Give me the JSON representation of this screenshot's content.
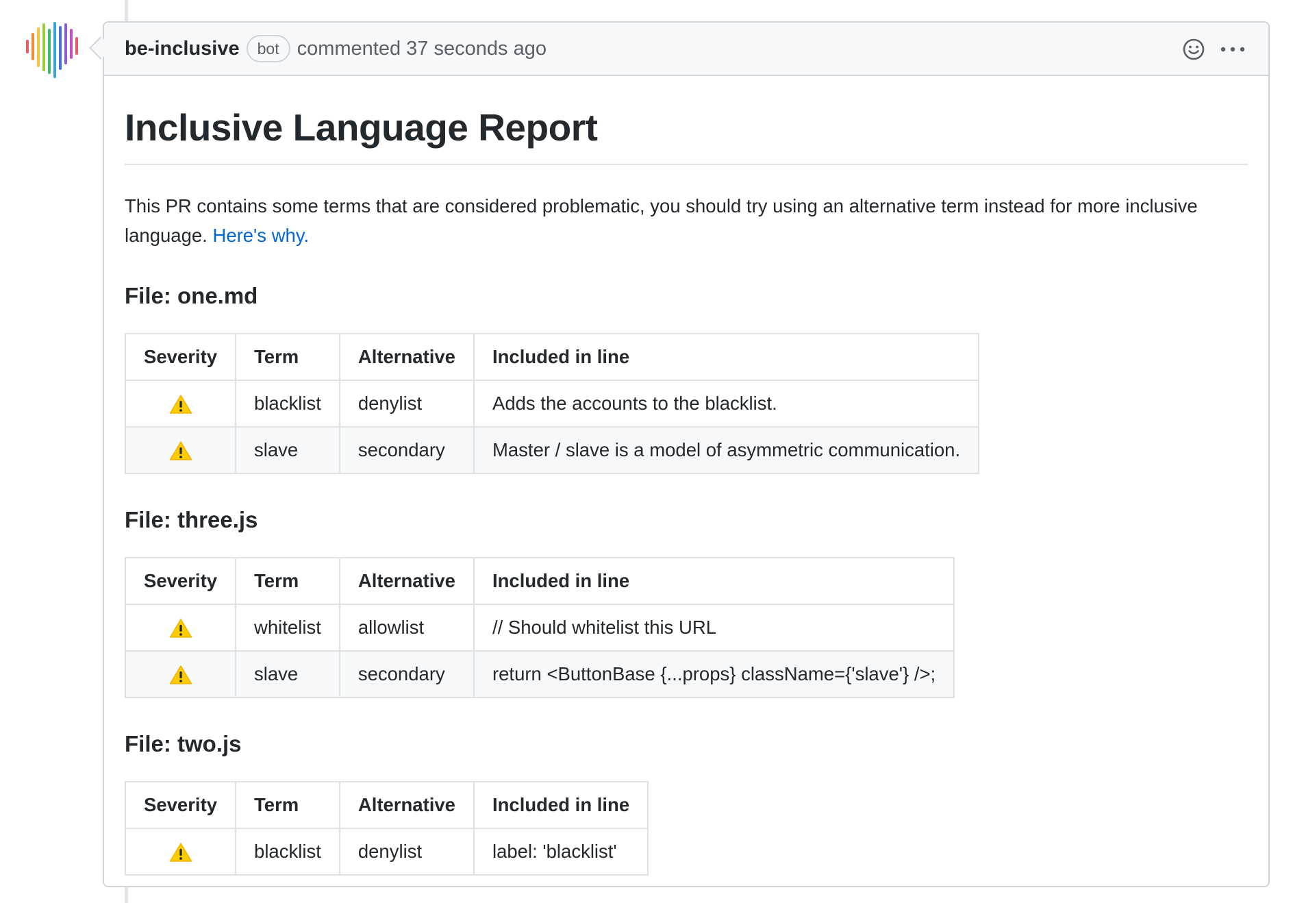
{
  "comment": {
    "author": "be-inclusive",
    "badge": "bot",
    "meta": "commented 37 seconds ago",
    "actions": [
      {
        "name": "add-reaction",
        "icon": "smiley-icon"
      },
      {
        "name": "more-options",
        "icon": "kebab-horizontal-icon"
      }
    ]
  },
  "report": {
    "title": "Inclusive Language Report",
    "intro": "This PR contains some terms that are considered problematic, you should try using an alternative term instead for more inclusive language.",
    "link": "Here's why.",
    "columns": [
      "Severity",
      "Term",
      "Alternative",
      "Included in line"
    ],
    "severity_icon": "warning-icon",
    "files": [
      {
        "heading": "File: one.md",
        "rows": [
          {
            "term": "blacklist",
            "alternative": "denylist",
            "line": "Adds the accounts to the blacklist."
          },
          {
            "term": "slave",
            "alternative": "secondary",
            "line": "Master / slave is a model of asymmetric communication."
          }
        ]
      },
      {
        "heading": "File: three.js",
        "rows": [
          {
            "term": "whitelist",
            "alternative": "allowlist",
            "line": "// Should whitelist this URL"
          },
          {
            "term": "slave",
            "alternative": "secondary",
            "line": "return <ButtonBase {...props} className={'slave'} />;"
          }
        ]
      },
      {
        "heading": "File: two.js",
        "rows": [
          {
            "term": "blacklist",
            "alternative": "denylist",
            "line": "label: 'blacklist'"
          }
        ]
      }
    ]
  },
  "colors": {
    "link": "#0366d6",
    "border": "#d1d5da",
    "header_bg": "#f6f8fa",
    "warning": "#ffcc00",
    "avatar_bars": [
      "#e35d6a",
      "#f08c3a",
      "#f5c242",
      "#9ccc3c",
      "#3dbb6a",
      "#3aa6d8",
      "#4a6fd8",
      "#8a5cd8",
      "#c450c8",
      "#e35d6a"
    ]
  }
}
